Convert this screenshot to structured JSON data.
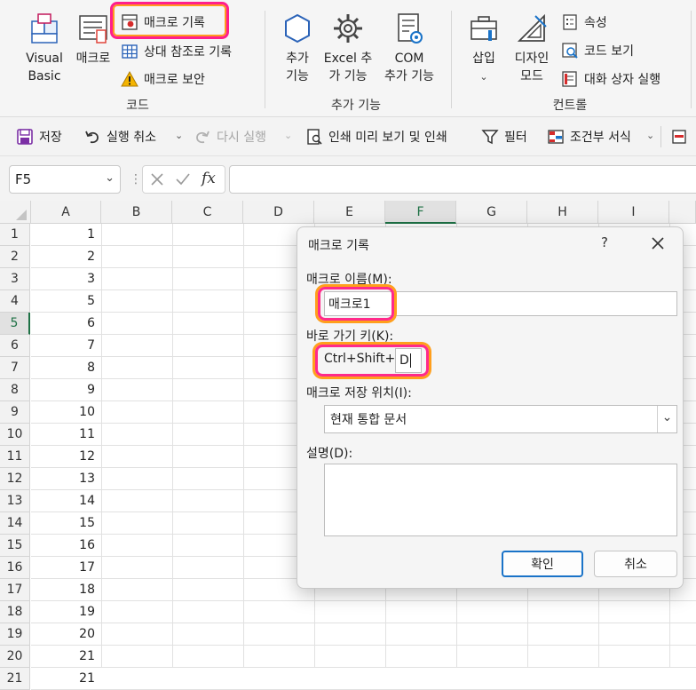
{
  "ribbon": {
    "code_group": {
      "visual_basic": "Visual\nBasic",
      "macro": "매크로",
      "record_macro": "매크로 기록",
      "relative_ref": "상대 참조로 기록",
      "macro_security": "매크로 보안",
      "label": "코드"
    },
    "addins_group": {
      "addins": "추가\n기능",
      "excel_addins": "Excel 추\n가 기능",
      "com_addins": "COM\n추가 기능",
      "label": "추가 기능"
    },
    "controls_group": {
      "insert": "삽입",
      "design_mode": "디자인\n모드",
      "properties": "속성",
      "view_code": "코드 보기",
      "run_dialog": "대화 상자 실행",
      "label": "컨트롤"
    }
  },
  "qat": {
    "save": "저장",
    "undo": "실행 취소",
    "redo": "다시 실행",
    "print_preview": "인쇄 미리 보기 및 인쇄",
    "filter": "필터",
    "conditional_format": "조건부 서식"
  },
  "formula_bar": {
    "name_box": "F5",
    "formula": ""
  },
  "sheet": {
    "columns": [
      "A",
      "B",
      "C",
      "D",
      "E",
      "F",
      "G",
      "H",
      "I"
    ],
    "active_column": "F",
    "active_row": 5,
    "rows": [
      1,
      2,
      3,
      4,
      5,
      6,
      7,
      8,
      9,
      10,
      11,
      12,
      13,
      14,
      15,
      16,
      17,
      18,
      19,
      20,
      21
    ],
    "col_a_values": [
      1,
      2,
      3,
      5,
      6,
      7,
      8,
      9,
      10,
      11,
      12,
      13,
      14,
      15,
      16,
      17,
      18,
      19,
      20,
      21,
      21
    ]
  },
  "dialog": {
    "title": "매크로 기록",
    "help": "?",
    "macro_name_label": "매크로 이름(M):",
    "macro_name_value": "매크로1",
    "shortcut_label": "바로 가기 키(K):",
    "shortcut_prefix": "Ctrl+Shift+",
    "shortcut_value": "D",
    "store_in_label": "매크로 저장 위치(I):",
    "store_in_value": "현재 통합 문서",
    "description_label": "설명(D):",
    "description_value": "",
    "ok_button": "확인",
    "cancel_button": "취소"
  },
  "colors": {
    "highlight_pink": "#ff1e8c",
    "highlight_orange": "#ff9a1f",
    "excel_green": "#1e7145",
    "accent_blue": "#1a73c8"
  }
}
